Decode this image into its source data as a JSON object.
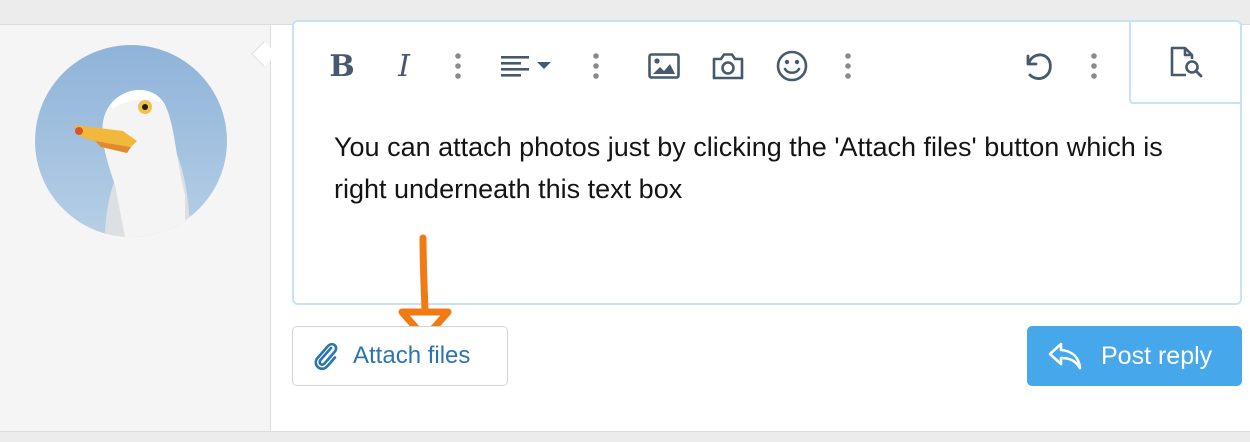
{
  "editor": {
    "content": "You can attach photos just by clicking the 'Attach files' button which is right underneath this text box"
  },
  "toolbar": {
    "bold_label": "B",
    "italic_label": "I"
  },
  "actions": {
    "attach_label": "Attach files",
    "post_label": "Post reply"
  },
  "colors": {
    "accent": "#47a7eb",
    "link": "#2b76ae",
    "annotation_arrow": "#f07a14",
    "editor_border": "#c9e2f3"
  },
  "icons": [
    "bold-icon",
    "italic-icon",
    "align-icon",
    "image-icon",
    "camera-icon",
    "smiley-icon",
    "undo-icon",
    "preview-icon",
    "paperclip-icon",
    "reply-icon"
  ]
}
